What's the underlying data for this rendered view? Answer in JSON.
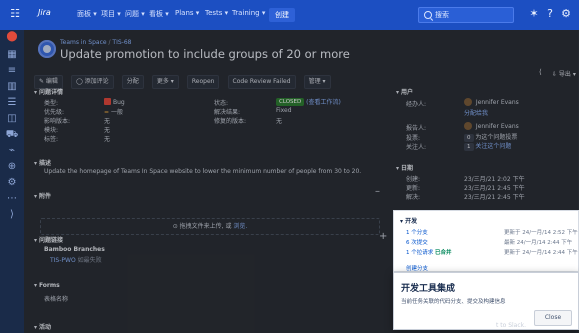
{
  "topbar": {
    "app_grid_icon": "grid-icon",
    "logo_text": "Jira",
    "nav": [
      "面板 ▾",
      "项目 ▾",
      "问题 ▾",
      "看板 ▾",
      "Plans ▾",
      "Tests ▾",
      "Training ▾"
    ],
    "create_label": "创建",
    "search_placeholder": "搜索",
    "icons": [
      "notifications-icon",
      "help-icon",
      "settings-icon",
      "user-avatar-icon"
    ]
  },
  "sidebar": {
    "icons": [
      "project-icon",
      "board-icon",
      "backlog-icon",
      "reports-icon",
      "issues-icon",
      "components-icon",
      "releases-icon",
      "shortcuts-icon",
      "add-shortcut-icon",
      "settings-icon"
    ]
  },
  "issue": {
    "breadcrumb_project": "Teams in Space",
    "breadcrumb_key": "TIS-68",
    "title": "Update promotion to include groups of 20 or more"
  },
  "toolbar": {
    "buttons": [
      "✎ 编辑",
      "◯ 添加评论",
      "分配",
      "更多 ▾",
      "Reopen",
      "Code Review Failed",
      "管理 ▾"
    ],
    "right_share_icon": "share-icon",
    "right_export_label": "⇩ 导出 ▾"
  },
  "details": {
    "section_title": "问题详情",
    "left": [
      {
        "label": "类型:",
        "value": "Bug",
        "type": "bug"
      },
      {
        "label": "优先级:",
        "value": "一般"
      },
      {
        "label": "影响版本:",
        "value": "无"
      },
      {
        "label": "模块:",
        "value": "无"
      },
      {
        "label": "标签:",
        "value": "无"
      }
    ],
    "right": [
      {
        "label": "状态:",
        "value": "CLOSED",
        "extra": "(查看工作流)"
      },
      {
        "label": "解决结果:",
        "value": "Fixed"
      },
      {
        "label": "修复的版本:",
        "value": "无"
      }
    ]
  },
  "description": {
    "section_title": "描述",
    "text": "Update the homepage of Teams In Space website to lower the minimum number of people from 30 to 20."
  },
  "attachments": {
    "section_title": "附件",
    "drop_text": "拖拽文件来上传, 或",
    "browse_text": "浏览."
  },
  "links": {
    "section_title": "问题链接",
    "group": "Bamboo Branches",
    "item_key": "TIS-PWO",
    "item_text": "如最失败"
  },
  "forms": {
    "section_title": "Forms",
    "item": "表格名称"
  },
  "activity": {
    "section_title": "活动"
  },
  "people": {
    "section_title": "用户",
    "rows": [
      {
        "label": "经办人:",
        "value": "Jennifer Evans"
      },
      {
        "label": "",
        "value": "分配给我",
        "link": true
      },
      {
        "label": "报告人:",
        "value": "Jennifer Evans"
      },
      {
        "label": "投票:",
        "value": "0",
        "suffix": "为这个问题投票"
      },
      {
        "label": "关注人:",
        "value": "1",
        "suffix": "关注这个问题"
      }
    ]
  },
  "dates": {
    "section_title": "日期",
    "rows": [
      {
        "label": "创建:",
        "value": "23/三月/21 2:02 下午"
      },
      {
        "label": "更新:",
        "value": "23/三月/21 2:45 下午"
      },
      {
        "label": "解决:",
        "value": "23/三月/21 2:45 下午"
      }
    ]
  },
  "development": {
    "section_title": "开发",
    "rows": [
      {
        "link": "1 个分支",
        "meta": "更新于 24/一月/14 2:52 下午"
      },
      {
        "link": "6 次提交",
        "meta": "最新 24/一月/14 2:44 下午"
      },
      {
        "link": "1 个拉请求",
        "status": "已合并",
        "meta": "更新于 24/一月/14 2:44 下午"
      }
    ],
    "create_branch": "创建分支"
  },
  "popup": {
    "title": "开发工具集成",
    "body": "当前任务关联的代码分支、提交及构建信息",
    "close_label": "Close"
  },
  "tail": {
    "text": "t to Slack."
  }
}
